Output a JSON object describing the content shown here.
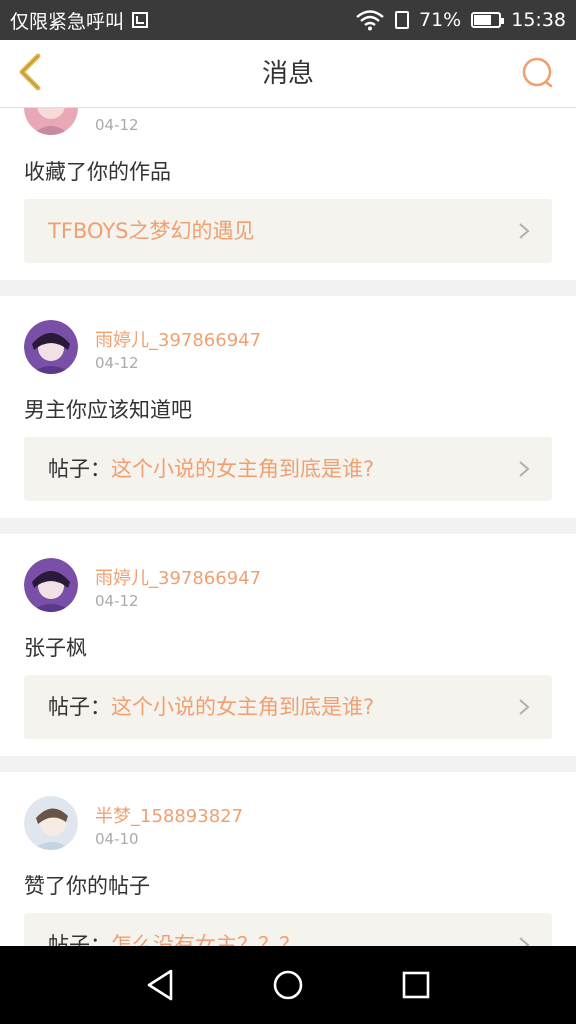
{
  "status_bar": {
    "carrier": "仅限紧急呼叫",
    "battery": "71%",
    "battery_level": 0.71,
    "time": "15:38"
  },
  "header": {
    "title": "消息"
  },
  "messages": [
    {
      "username": "",
      "date": "04-12",
      "text": "收藏了你的作品",
      "ref_prefix": "",
      "ref_title": "TFBOYS之梦幻的遇见"
    },
    {
      "username": "雨婷儿_397866947",
      "date": "04-12",
      "text": "男主你应该知道吧",
      "ref_prefix": "帖子：",
      "ref_title": "这个小说的女主角到底是谁?"
    },
    {
      "username": "雨婷儿_397866947",
      "date": "04-12",
      "text": "张子枫",
      "ref_prefix": "帖子：",
      "ref_title": "这个小说的女主角到底是谁?"
    },
    {
      "username": "半梦_158893827",
      "date": "04-10",
      "text": "赞了你的帖子",
      "ref_prefix": "帖子：",
      "ref_title": "怎么没有女主？？？"
    }
  ],
  "colors": {
    "accent": "#f0a070",
    "back_arrow": "#e6b84a"
  },
  "icons": {
    "back": "chevron-left-icon",
    "search": "search-icon",
    "ref_arrow": "chevron-right-icon",
    "nav_back": "triangle-back-icon",
    "nav_home": "circle-home-icon",
    "nav_recent": "square-recent-icon"
  }
}
